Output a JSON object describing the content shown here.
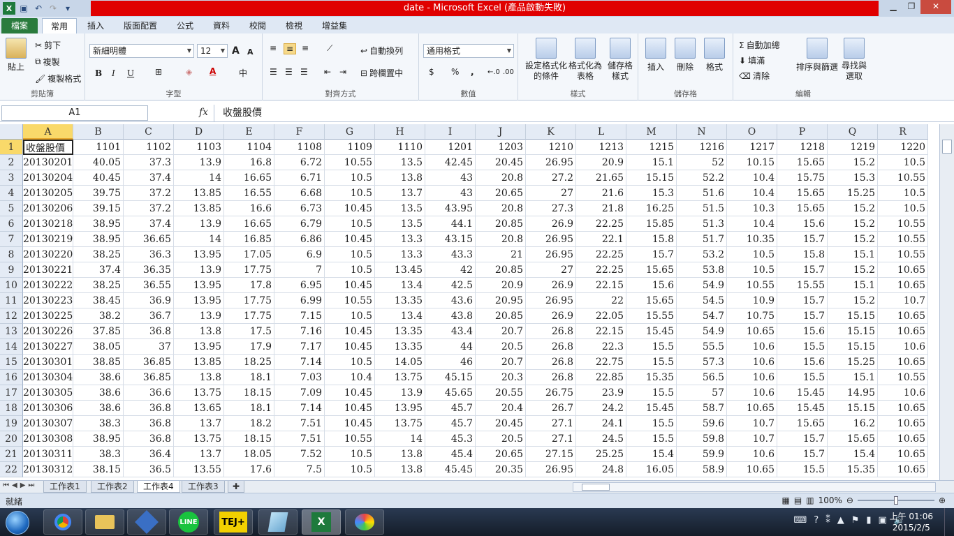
{
  "window": {
    "title": "date - Microsoft Excel (產品啟動失敗)",
    "controls": [
      "minimize-icon",
      "restore-icon",
      "close-icon"
    ]
  },
  "qat": [
    "save-icon",
    "undo-icon",
    "redo-icon",
    "customize-icon"
  ],
  "tabs": [
    "檔案",
    "常用",
    "插入",
    "版面配置",
    "公式",
    "資料",
    "校閱",
    "檢視",
    "增益集"
  ],
  "ribbon": {
    "clipboard": {
      "paste": "貼上",
      "cut": "剪下",
      "copy": "複製",
      "format_painter": "複製格式",
      "label": "剪貼簿"
    },
    "font": {
      "name": "新細明體",
      "size": "12",
      "grow": "A",
      "shrink": "A",
      "bold": "B",
      "italic": "I",
      "underline": "U",
      "label": "字型"
    },
    "alignment": {
      "wrap": "自動換列",
      "merge": "跨欄置中",
      "label": "對齊方式"
    },
    "number": {
      "format": "通用格式",
      "currency": "$",
      "percent": "%",
      "comma": ",",
      "label": "數值"
    },
    "styles": {
      "conditional": "設定格式化的條件",
      "as_table": "格式化為表格",
      "cell_styles": "儲存格樣式",
      "label": "樣式"
    },
    "cells": {
      "insert": "插入",
      "delete": "刪除",
      "format": "格式",
      "label": "儲存格"
    },
    "editing": {
      "autosum": "自動加總",
      "fill": "填滿",
      "clear": "清除",
      "sort": "排序與篩選",
      "find": "尋找與選取",
      "label": "編輯"
    }
  },
  "formula_bar": {
    "name_box": "A1",
    "fx": "fx",
    "content": "收盤股價"
  },
  "grid": {
    "columns": [
      "A",
      "B",
      "C",
      "D",
      "E",
      "F",
      "G",
      "H",
      "I",
      "J",
      "K",
      "L",
      "M",
      "N",
      "O",
      "P",
      "Q",
      "R"
    ],
    "rows": [
      [
        "收盤股價",
        "1101",
        "1102",
        "1103",
        "1104",
        "1108",
        "1109",
        "1110",
        "1201",
        "1203",
        "1210",
        "1213",
        "1215",
        "1216",
        "1217",
        "1218",
        "1219",
        "1220"
      ],
      [
        "20130201",
        "40.05",
        "37.3",
        "13.9",
        "16.8",
        "6.72",
        "10.55",
        "13.5",
        "42.45",
        "20.45",
        "26.95",
        "20.9",
        "15.1",
        "52",
        "10.15",
        "15.65",
        "15.2",
        "10.5"
      ],
      [
        "20130204",
        "40.45",
        "37.4",
        "14",
        "16.65",
        "6.71",
        "10.5",
        "13.8",
        "43",
        "20.8",
        "27.2",
        "21.65",
        "15.15",
        "52.2",
        "10.4",
        "15.75",
        "15.3",
        "10.55"
      ],
      [
        "20130205",
        "39.75",
        "37.2",
        "13.85",
        "16.55",
        "6.68",
        "10.5",
        "13.7",
        "43",
        "20.65",
        "27",
        "21.6",
        "15.3",
        "51.6",
        "10.4",
        "15.65",
        "15.25",
        "10.5"
      ],
      [
        "20130206",
        "39.15",
        "37.2",
        "13.85",
        "16.6",
        "6.73",
        "10.45",
        "13.5",
        "43.95",
        "20.8",
        "27.3",
        "21.8",
        "16.25",
        "51.5",
        "10.3",
        "15.65",
        "15.2",
        "10.5"
      ],
      [
        "20130218",
        "38.95",
        "37.4",
        "13.9",
        "16.65",
        "6.79",
        "10.5",
        "13.5",
        "44.1",
        "20.85",
        "26.9",
        "22.25",
        "15.85",
        "51.3",
        "10.4",
        "15.6",
        "15.2",
        "10.55"
      ],
      [
        "20130219",
        "38.95",
        "36.65",
        "14",
        "16.85",
        "6.86",
        "10.45",
        "13.3",
        "43.15",
        "20.8",
        "26.95",
        "22.1",
        "15.8",
        "51.7",
        "10.35",
        "15.7",
        "15.2",
        "10.55"
      ],
      [
        "20130220",
        "38.25",
        "36.3",
        "13.95",
        "17.05",
        "6.9",
        "10.5",
        "13.3",
        "43.3",
        "21",
        "26.95",
        "22.25",
        "15.7",
        "53.2",
        "10.5",
        "15.8",
        "15.1",
        "10.55"
      ],
      [
        "20130221",
        "37.4",
        "36.35",
        "13.9",
        "17.75",
        "7",
        "10.5",
        "13.45",
        "42",
        "20.85",
        "27",
        "22.25",
        "15.65",
        "53.8",
        "10.5",
        "15.7",
        "15.2",
        "10.65"
      ],
      [
        "20130222",
        "38.25",
        "36.55",
        "13.95",
        "17.8",
        "6.95",
        "10.45",
        "13.4",
        "42.5",
        "20.9",
        "26.9",
        "22.15",
        "15.6",
        "54.9",
        "10.55",
        "15.55",
        "15.1",
        "10.65"
      ],
      [
        "20130223",
        "38.45",
        "36.9",
        "13.95",
        "17.75",
        "6.99",
        "10.55",
        "13.35",
        "43.6",
        "20.95",
        "26.95",
        "22",
        "15.65",
        "54.5",
        "10.9",
        "15.7",
        "15.2",
        "10.7"
      ],
      [
        "20130225",
        "38.2",
        "36.7",
        "13.9",
        "17.75",
        "7.15",
        "10.5",
        "13.4",
        "43.8",
        "20.85",
        "26.9",
        "22.05",
        "15.55",
        "54.7",
        "10.75",
        "15.7",
        "15.15",
        "10.65"
      ],
      [
        "20130226",
        "37.85",
        "36.8",
        "13.8",
        "17.5",
        "7.16",
        "10.45",
        "13.35",
        "43.4",
        "20.7",
        "26.8",
        "22.15",
        "15.45",
        "54.9",
        "10.65",
        "15.6",
        "15.15",
        "10.65"
      ],
      [
        "20130227",
        "38.05",
        "37",
        "13.95",
        "17.9",
        "7.17",
        "10.45",
        "13.35",
        "44",
        "20.5",
        "26.8",
        "22.3",
        "15.5",
        "55.5",
        "10.6",
        "15.5",
        "15.15",
        "10.6"
      ],
      [
        "20130301",
        "38.85",
        "36.85",
        "13.85",
        "18.25",
        "7.14",
        "10.5",
        "14.05",
        "46",
        "20.7",
        "26.8",
        "22.75",
        "15.5",
        "57.3",
        "10.6",
        "15.6",
        "15.25",
        "10.65"
      ],
      [
        "20130304",
        "38.6",
        "36.85",
        "13.8",
        "18.1",
        "7.03",
        "10.4",
        "13.75",
        "45.15",
        "20.3",
        "26.8",
        "22.85",
        "15.35",
        "56.5",
        "10.6",
        "15.5",
        "15.1",
        "10.55"
      ],
      [
        "20130305",
        "38.6",
        "36.6",
        "13.75",
        "18.15",
        "7.09",
        "10.45",
        "13.9",
        "45.65",
        "20.55",
        "26.75",
        "23.9",
        "15.5",
        "57",
        "10.6",
        "15.45",
        "14.95",
        "10.6"
      ],
      [
        "20130306",
        "38.6",
        "36.8",
        "13.65",
        "18.1",
        "7.14",
        "10.45",
        "13.95",
        "45.7",
        "20.4",
        "26.7",
        "24.2",
        "15.45",
        "58.7",
        "10.65",
        "15.45",
        "15.15",
        "10.65"
      ],
      [
        "20130307",
        "38.3",
        "36.8",
        "13.7",
        "18.2",
        "7.51",
        "10.45",
        "13.75",
        "45.7",
        "20.45",
        "27.1",
        "24.1",
        "15.5",
        "59.6",
        "10.7",
        "15.65",
        "16.2",
        "10.65"
      ],
      [
        "20130308",
        "38.95",
        "36.8",
        "13.75",
        "18.15",
        "7.51",
        "10.55",
        "14",
        "45.3",
        "20.5",
        "27.1",
        "24.5",
        "15.5",
        "59.8",
        "10.7",
        "15.7",
        "15.65",
        "10.65"
      ],
      [
        "20130311",
        "38.3",
        "36.4",
        "13.7",
        "18.05",
        "7.52",
        "10.5",
        "13.8",
        "45.4",
        "20.65",
        "27.15",
        "25.25",
        "15.4",
        "59.9",
        "10.6",
        "15.7",
        "15.4",
        "10.65"
      ],
      [
        "20130312",
        "38.15",
        "36.5",
        "13.55",
        "17.6",
        "7.5",
        "10.5",
        "13.8",
        "45.45",
        "20.35",
        "26.95",
        "24.8",
        "16.05",
        "58.9",
        "10.65",
        "15.5",
        "15.35",
        "10.65"
      ]
    ]
  },
  "sheets": [
    "工作表1",
    "工作表2",
    "工作表4",
    "工作表3"
  ],
  "active_sheet": "工作表4",
  "status": {
    "ready": "就緒",
    "zoom": "100%"
  },
  "taskbar": {
    "apps": [
      "chrome-icon",
      "explorer-icon",
      "app-icon",
      "LINE",
      "TEJ+",
      "notes-icon",
      "excel-icon",
      "paint-icon"
    ],
    "clock_time": "上午 01:06",
    "clock_date": "2015/2/5"
  }
}
